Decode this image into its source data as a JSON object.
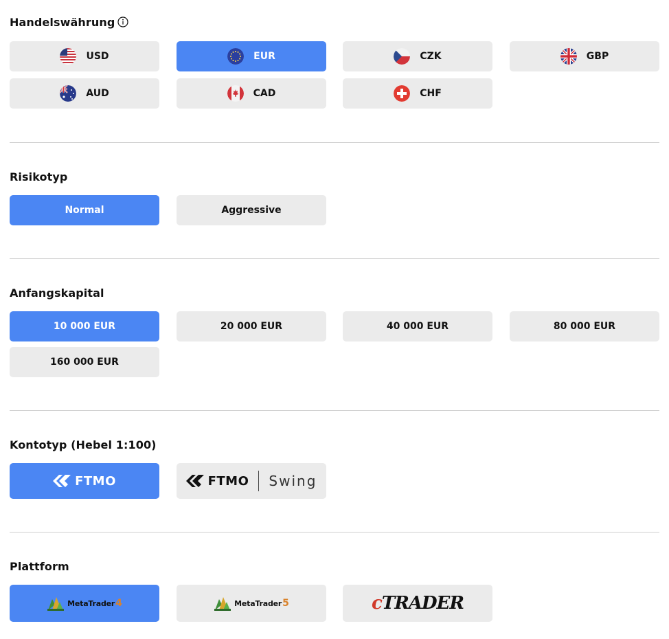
{
  "currency": {
    "title": "Handelswährung",
    "options": [
      "USD",
      "EUR",
      "CZK",
      "GBP",
      "AUD",
      "CAD",
      "CHF"
    ],
    "selected": "EUR"
  },
  "risk": {
    "title": "Risikotyp",
    "options": [
      "Normal",
      "Aggressive"
    ],
    "selected": "Normal"
  },
  "capital": {
    "title": "Anfangskapital",
    "options": [
      "10 000 EUR",
      "20 000 EUR",
      "40 000 EUR",
      "80 000 EUR",
      "160 000 EUR"
    ],
    "selected": "10 000 EUR"
  },
  "account": {
    "title": "Kontotyp (Hebel 1:100)",
    "ftmo_logo": "FTMO",
    "swing_label": "Swing",
    "selected": "FTMO"
  },
  "platform": {
    "title": "Plattform",
    "mt4": {
      "name": "MetaTrader",
      "num": "4"
    },
    "mt5": {
      "name": "MetaTrader",
      "num": "5"
    },
    "ctrader": {
      "c": "c",
      "rest": "TRADER"
    },
    "selected": "MetaTrader 4"
  },
  "colors": {
    "accent": "#4b86f3",
    "button": "#ebebeb",
    "divider": "#cfcfcf"
  }
}
